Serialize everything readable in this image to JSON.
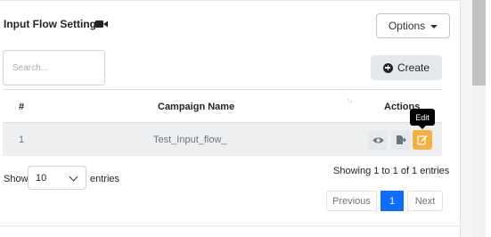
{
  "header": {
    "title": "Input Flow Settings",
    "title_icon": "video-camera-icon",
    "options_label": "Options"
  },
  "search": {
    "placeholder": "Search..."
  },
  "create": {
    "label": "Create",
    "icon": "plus-circle-icon"
  },
  "table": {
    "columns": [
      "#",
      "Campaign Name",
      "Actions"
    ],
    "sort_icon": "sort-icon",
    "rows": [
      {
        "num": "1",
        "campaign_name": "Test_Input_flow_",
        "actions": [
          "view-icon",
          "export-icon",
          "edit-icon"
        ]
      }
    ],
    "tooltip": "Edit"
  },
  "footer": {
    "show_label": "Show",
    "page_length": "10",
    "entries_label": "entries",
    "info": "Showing 1 to 1 of 1 entries",
    "pagination": {
      "previous": "Previous",
      "current": "1",
      "next": "Next"
    }
  },
  "colors": {
    "edit_accent": "#f5b03f",
    "pagination_active": "#0d6efd",
    "row_bg": "#eeeff1"
  }
}
